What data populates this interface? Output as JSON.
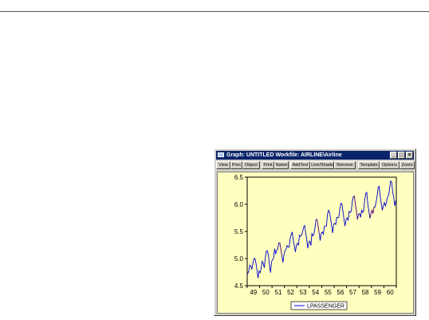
{
  "window": {
    "title": "Graph: UNTITLED   Workfile: AIRLINE\\Airline",
    "buttons": {
      "minimize": "_",
      "maximize": "□",
      "close": "×"
    }
  },
  "toolbar": {
    "buttons": [
      "View",
      "Proc",
      "Object",
      "Print",
      "Name",
      "AddText",
      "Line/Shade",
      "Remove",
      "Template",
      "Options",
      "Zoom"
    ]
  },
  "colors": {
    "titlebar": "#0a246a",
    "graph_background": "#ffffc0",
    "series_primary": "#0000cc",
    "series_secondary": "#cc0000"
  },
  "chart_data": {
    "type": "line",
    "title": "",
    "xlabel": "",
    "ylabel": "",
    "x_tick_labels": [
      "49",
      "50",
      "51",
      "52",
      "53",
      "54",
      "55",
      "56",
      "57",
      "58",
      "59",
      "60"
    ],
    "y_tick_labels": [
      "4.5",
      "5.0",
      "5.5",
      "6.0",
      "6.5"
    ],
    "ylim": [
      4.5,
      6.5
    ],
    "xlim": [
      1949.0,
      1961.0
    ],
    "grid": false,
    "legend_position": "bottom-center",
    "series": [
      {
        "name": "LPASSENGER",
        "x_start": 1949.0,
        "frequency": "monthly",
        "values": [
          4.72,
          4.77,
          4.88,
          4.86,
          4.8,
          4.91,
          5.0,
          5.0,
          4.91,
          4.78,
          4.64,
          4.77,
          4.74,
          4.83,
          4.95,
          4.91,
          4.83,
          5.01,
          5.14,
          5.14,
          5.06,
          4.89,
          4.74,
          4.94,
          4.98,
          5.01,
          5.18,
          5.09,
          5.15,
          5.18,
          5.29,
          5.29,
          5.16,
          5.06,
          4.93,
          5.07,
          5.14,
          5.17,
          5.24,
          5.21,
          5.21,
          5.37,
          5.44,
          5.49,
          5.34,
          5.24,
          5.12,
          5.24,
          5.28,
          5.25,
          5.43,
          5.41,
          5.43,
          5.49,
          5.58,
          5.61,
          5.47,
          5.35,
          5.19,
          5.3,
          5.32,
          5.24,
          5.46,
          5.42,
          5.46,
          5.57,
          5.72,
          5.72,
          5.6,
          5.47,
          5.33,
          5.47,
          5.49,
          5.45,
          5.59,
          5.6,
          5.6,
          5.81,
          5.89,
          5.85,
          5.74,
          5.61,
          5.47,
          5.63,
          5.65,
          5.63,
          5.76,
          5.75,
          5.76,
          5.92,
          6.02,
          6.0,
          5.87,
          5.72,
          5.6,
          5.72,
          5.75,
          5.71,
          5.87,
          5.85,
          5.87,
          6.05,
          6.14,
          6.15,
          5.99,
          5.88,
          5.72,
          5.82,
          5.83,
          5.76,
          5.89,
          5.85,
          5.89,
          6.08,
          6.2,
          6.22,
          6.0,
          5.88,
          5.74,
          5.82,
          5.89,
          5.83,
          5.95,
          5.95,
          6.04,
          6.16,
          6.31,
          6.33,
          6.14,
          6.01,
          5.89,
          5.97,
          6.03,
          5.97,
          6.04,
          6.13,
          6.16,
          6.28,
          6.43,
          6.41,
          6.23,
          6.13,
          5.97,
          6.07
        ]
      }
    ]
  }
}
